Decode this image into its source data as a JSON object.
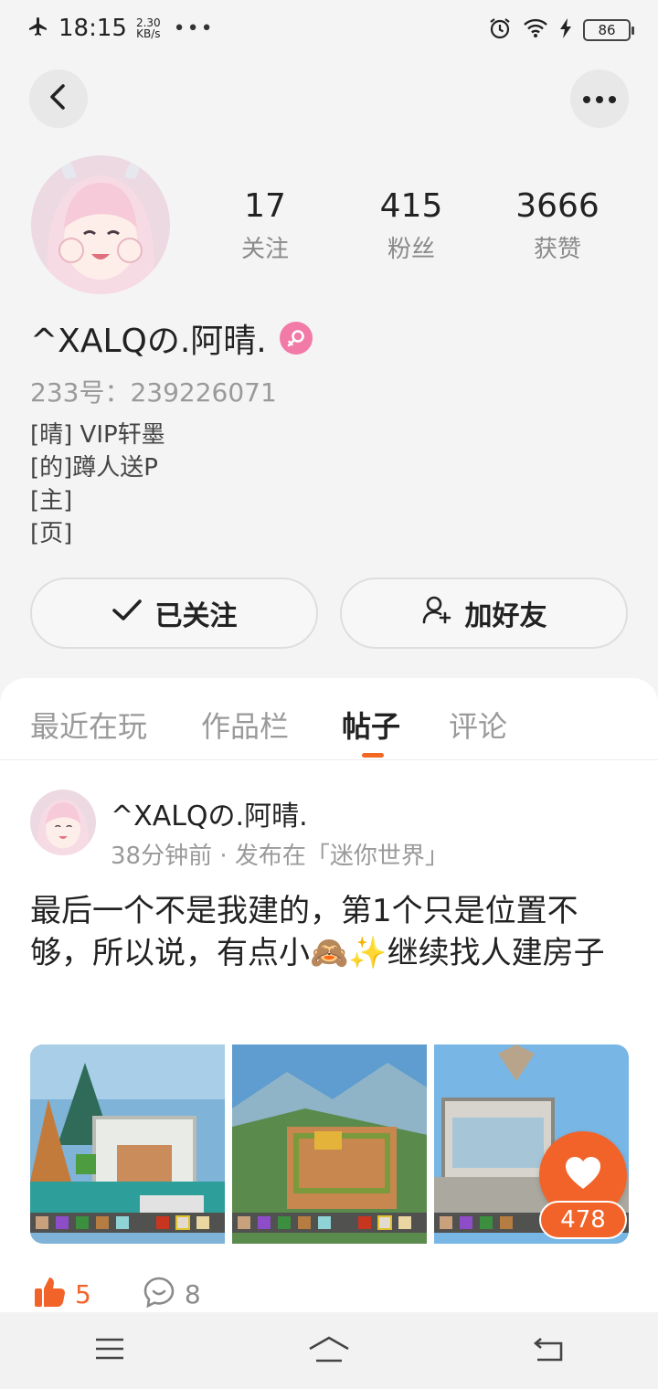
{
  "status_bar": {
    "time": "18:15",
    "speed_value": "2.30",
    "speed_unit": "KB/s",
    "more": "•••",
    "battery": "86"
  },
  "profile": {
    "following_count": "17",
    "following_label": "关注",
    "followers_count": "415",
    "followers_label": "粉丝",
    "likes_count": "3666",
    "likes_label": "获赞",
    "username": "^XALQの.阿晴.",
    "id_line": "233号：239226071",
    "bio_lines": [
      "[晴] VIP轩墨",
      "[的]蹲人送P",
      "[主]",
      "[页]"
    ],
    "follow_button": "已关注",
    "add_friend_button": "加好友"
  },
  "tabs": [
    {
      "label": "最近在玩"
    },
    {
      "label": "作品栏"
    },
    {
      "label": "帖子"
    },
    {
      "label": "评论"
    }
  ],
  "active_tab": "帖子",
  "post": {
    "author": "^XALQの.阿晴.",
    "meta": "38分钟前 · 发布在「迷你世界」",
    "text": "最后一个不是我建的，第1个只是位置不够，所以说，有点小🙈✨继续找人建房子",
    "thumbs_up": "5",
    "comments": "8"
  },
  "floating_like_count": "478",
  "colors": {
    "accent": "#f2632a",
    "gender_badge": "#f27aa6",
    "background": "#f4f4f4"
  },
  "icons": [
    "airplane-icon",
    "alarm-icon",
    "wifi-icon",
    "charging-icon",
    "back-icon",
    "more-icon",
    "female-icon",
    "check-icon",
    "add-user-icon",
    "heart-icon",
    "thumbs-up-icon",
    "comment-icon",
    "menu-icon",
    "home-icon",
    "return-icon"
  ]
}
